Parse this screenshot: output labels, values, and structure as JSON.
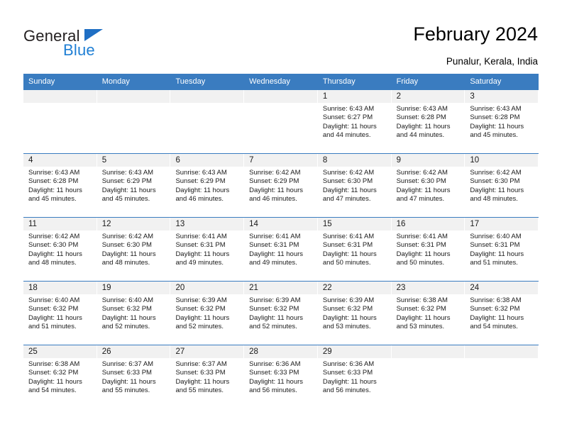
{
  "brand": {
    "name_top": "General",
    "name_bottom": "Blue",
    "triangle_color": "#1f6fc4",
    "blue_color": "#1f7fd4"
  },
  "header": {
    "title": "February 2024",
    "location": "Punalur, Kerala, India"
  },
  "theme": {
    "header_blue": "#3a7cc0",
    "daynum_band": "#f1f1f1",
    "text": "#1a1a1a",
    "page_background": "#ffffff"
  },
  "weekdays": [
    "Sunday",
    "Monday",
    "Tuesday",
    "Wednesday",
    "Thursday",
    "Friday",
    "Saturday"
  ],
  "weeks": [
    [
      {
        "day": "",
        "sunrise": "",
        "sunset": "",
        "daylight_line1": "",
        "daylight_line2": ""
      },
      {
        "day": "",
        "sunrise": "",
        "sunset": "",
        "daylight_line1": "",
        "daylight_line2": ""
      },
      {
        "day": "",
        "sunrise": "",
        "sunset": "",
        "daylight_line1": "",
        "daylight_line2": ""
      },
      {
        "day": "",
        "sunrise": "",
        "sunset": "",
        "daylight_line1": "",
        "daylight_line2": ""
      },
      {
        "day": "1",
        "sunrise": "Sunrise: 6:43 AM",
        "sunset": "Sunset: 6:27 PM",
        "daylight_line1": "Daylight: 11 hours",
        "daylight_line2": "and 44 minutes."
      },
      {
        "day": "2",
        "sunrise": "Sunrise: 6:43 AM",
        "sunset": "Sunset: 6:28 PM",
        "daylight_line1": "Daylight: 11 hours",
        "daylight_line2": "and 44 minutes."
      },
      {
        "day": "3",
        "sunrise": "Sunrise: 6:43 AM",
        "sunset": "Sunset: 6:28 PM",
        "daylight_line1": "Daylight: 11 hours",
        "daylight_line2": "and 45 minutes."
      }
    ],
    [
      {
        "day": "4",
        "sunrise": "Sunrise: 6:43 AM",
        "sunset": "Sunset: 6:28 PM",
        "daylight_line1": "Daylight: 11 hours",
        "daylight_line2": "and 45 minutes."
      },
      {
        "day": "5",
        "sunrise": "Sunrise: 6:43 AM",
        "sunset": "Sunset: 6:29 PM",
        "daylight_line1": "Daylight: 11 hours",
        "daylight_line2": "and 45 minutes."
      },
      {
        "day": "6",
        "sunrise": "Sunrise: 6:43 AM",
        "sunset": "Sunset: 6:29 PM",
        "daylight_line1": "Daylight: 11 hours",
        "daylight_line2": "and 46 minutes."
      },
      {
        "day": "7",
        "sunrise": "Sunrise: 6:42 AM",
        "sunset": "Sunset: 6:29 PM",
        "daylight_line1": "Daylight: 11 hours",
        "daylight_line2": "and 46 minutes."
      },
      {
        "day": "8",
        "sunrise": "Sunrise: 6:42 AM",
        "sunset": "Sunset: 6:30 PM",
        "daylight_line1": "Daylight: 11 hours",
        "daylight_line2": "and 47 minutes."
      },
      {
        "day": "9",
        "sunrise": "Sunrise: 6:42 AM",
        "sunset": "Sunset: 6:30 PM",
        "daylight_line1": "Daylight: 11 hours",
        "daylight_line2": "and 47 minutes."
      },
      {
        "day": "10",
        "sunrise": "Sunrise: 6:42 AM",
        "sunset": "Sunset: 6:30 PM",
        "daylight_line1": "Daylight: 11 hours",
        "daylight_line2": "and 48 minutes."
      }
    ],
    [
      {
        "day": "11",
        "sunrise": "Sunrise: 6:42 AM",
        "sunset": "Sunset: 6:30 PM",
        "daylight_line1": "Daylight: 11 hours",
        "daylight_line2": "and 48 minutes."
      },
      {
        "day": "12",
        "sunrise": "Sunrise: 6:42 AM",
        "sunset": "Sunset: 6:30 PM",
        "daylight_line1": "Daylight: 11 hours",
        "daylight_line2": "and 48 minutes."
      },
      {
        "day": "13",
        "sunrise": "Sunrise: 6:41 AM",
        "sunset": "Sunset: 6:31 PM",
        "daylight_line1": "Daylight: 11 hours",
        "daylight_line2": "and 49 minutes."
      },
      {
        "day": "14",
        "sunrise": "Sunrise: 6:41 AM",
        "sunset": "Sunset: 6:31 PM",
        "daylight_line1": "Daylight: 11 hours",
        "daylight_line2": "and 49 minutes."
      },
      {
        "day": "15",
        "sunrise": "Sunrise: 6:41 AM",
        "sunset": "Sunset: 6:31 PM",
        "daylight_line1": "Daylight: 11 hours",
        "daylight_line2": "and 50 minutes."
      },
      {
        "day": "16",
        "sunrise": "Sunrise: 6:41 AM",
        "sunset": "Sunset: 6:31 PM",
        "daylight_line1": "Daylight: 11 hours",
        "daylight_line2": "and 50 minutes."
      },
      {
        "day": "17",
        "sunrise": "Sunrise: 6:40 AM",
        "sunset": "Sunset: 6:31 PM",
        "daylight_line1": "Daylight: 11 hours",
        "daylight_line2": "and 51 minutes."
      }
    ],
    [
      {
        "day": "18",
        "sunrise": "Sunrise: 6:40 AM",
        "sunset": "Sunset: 6:32 PM",
        "daylight_line1": "Daylight: 11 hours",
        "daylight_line2": "and 51 minutes."
      },
      {
        "day": "19",
        "sunrise": "Sunrise: 6:40 AM",
        "sunset": "Sunset: 6:32 PM",
        "daylight_line1": "Daylight: 11 hours",
        "daylight_line2": "and 52 minutes."
      },
      {
        "day": "20",
        "sunrise": "Sunrise: 6:39 AM",
        "sunset": "Sunset: 6:32 PM",
        "daylight_line1": "Daylight: 11 hours",
        "daylight_line2": "and 52 minutes."
      },
      {
        "day": "21",
        "sunrise": "Sunrise: 6:39 AM",
        "sunset": "Sunset: 6:32 PM",
        "daylight_line1": "Daylight: 11 hours",
        "daylight_line2": "and 52 minutes."
      },
      {
        "day": "22",
        "sunrise": "Sunrise: 6:39 AM",
        "sunset": "Sunset: 6:32 PM",
        "daylight_line1": "Daylight: 11 hours",
        "daylight_line2": "and 53 minutes."
      },
      {
        "day": "23",
        "sunrise": "Sunrise: 6:38 AM",
        "sunset": "Sunset: 6:32 PM",
        "daylight_line1": "Daylight: 11 hours",
        "daylight_line2": "and 53 minutes."
      },
      {
        "day": "24",
        "sunrise": "Sunrise: 6:38 AM",
        "sunset": "Sunset: 6:32 PM",
        "daylight_line1": "Daylight: 11 hours",
        "daylight_line2": "and 54 minutes."
      }
    ],
    [
      {
        "day": "25",
        "sunrise": "Sunrise: 6:38 AM",
        "sunset": "Sunset: 6:32 PM",
        "daylight_line1": "Daylight: 11 hours",
        "daylight_line2": "and 54 minutes."
      },
      {
        "day": "26",
        "sunrise": "Sunrise: 6:37 AM",
        "sunset": "Sunset: 6:33 PM",
        "daylight_line1": "Daylight: 11 hours",
        "daylight_line2": "and 55 minutes."
      },
      {
        "day": "27",
        "sunrise": "Sunrise: 6:37 AM",
        "sunset": "Sunset: 6:33 PM",
        "daylight_line1": "Daylight: 11 hours",
        "daylight_line2": "and 55 minutes."
      },
      {
        "day": "28",
        "sunrise": "Sunrise: 6:36 AM",
        "sunset": "Sunset: 6:33 PM",
        "daylight_line1": "Daylight: 11 hours",
        "daylight_line2": "and 56 minutes."
      },
      {
        "day": "29",
        "sunrise": "Sunrise: 6:36 AM",
        "sunset": "Sunset: 6:33 PM",
        "daylight_line1": "Daylight: 11 hours",
        "daylight_line2": "and 56 minutes."
      },
      {
        "day": "",
        "sunrise": "",
        "sunset": "",
        "daylight_line1": "",
        "daylight_line2": ""
      },
      {
        "day": "",
        "sunrise": "",
        "sunset": "",
        "daylight_line1": "",
        "daylight_line2": ""
      }
    ]
  ]
}
